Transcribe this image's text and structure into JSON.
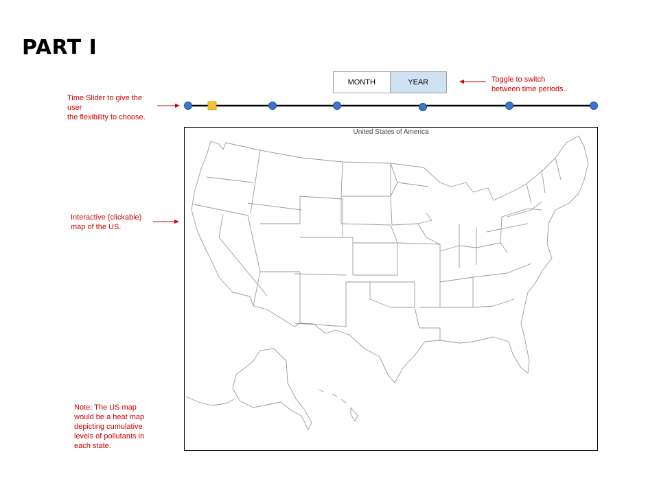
{
  "page": {
    "title": "PART I"
  },
  "toggle": {
    "month_label": "MONTH",
    "year_label": "YEAR",
    "selected": "YEAR",
    "selected_color": "#cfe2f3"
  },
  "slider": {
    "node_color": "#3d78c7",
    "handle_color": "#f1c232",
    "stops": 7,
    "handle_position_fraction": 0.06
  },
  "annotations": {
    "slider_note": "Time Slider to give the\nuser\nthe flexibility to choose.",
    "toggle_note": "Toggle to switch\nbetween time periods..",
    "map_note": "Interactive (clickable)\nmap of the US.",
    "heatmap_note": "Note: The US map\nwould be a heat map\ndepicting cumulative\nlevels of pollutants in\neach state.",
    "annotation_color": "#cc0000"
  },
  "map": {
    "title": "United States of America",
    "outline_color": "#9a9a9a"
  }
}
